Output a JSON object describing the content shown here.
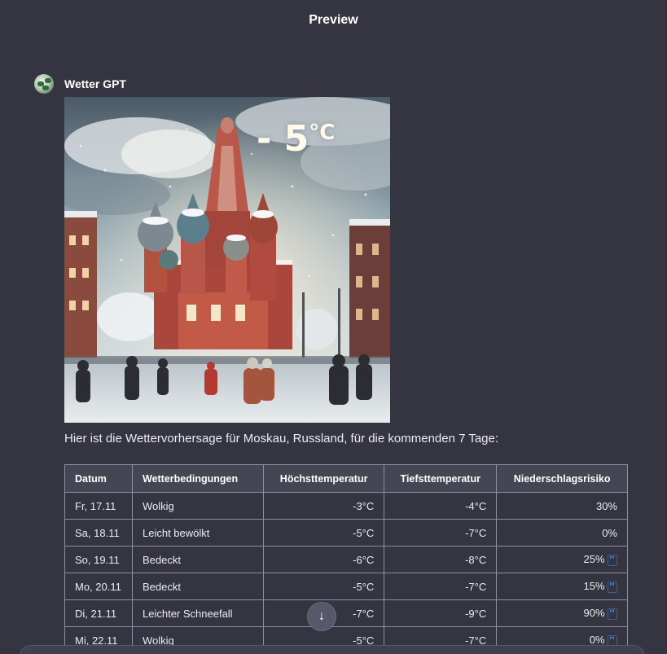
{
  "header": {
    "title": "Preview"
  },
  "message": {
    "author": "Wetter GPT",
    "image": {
      "temperature_overlay": "- 5",
      "temperature_unit": "°C"
    },
    "intro": "Hier ist die Wettervorhersage für Moskau, Russland, für die kommenden 7 Tage:"
  },
  "forecast": {
    "columns": [
      "Datum",
      "Wetterbedingungen",
      "Höchsttemperatur",
      "Tiefsttemperatur",
      "Niederschlagsrisiko"
    ],
    "rows": [
      {
        "date": "Fr, 17.11",
        "condition": "Wolkig",
        "high": "-3°C",
        "low": "-4°C",
        "precip": "30%",
        "precip_icon": false
      },
      {
        "date": "Sa, 18.11",
        "condition": "Leicht bewölkt",
        "high": "-5°C",
        "low": "-7°C",
        "precip": "0%",
        "precip_icon": false
      },
      {
        "date": "So, 19.11",
        "condition": "Bedeckt",
        "high": "-6°C",
        "low": "-8°C",
        "precip": "25%",
        "precip_icon": true
      },
      {
        "date": "Mo, 20.11",
        "condition": "Bedeckt",
        "high": "-5°C",
        "low": "-7°C",
        "precip": "15%",
        "precip_icon": true
      },
      {
        "date": "Di, 21.11",
        "condition": "Leichter Schneefall",
        "high": "-7°C",
        "low": "-9°C",
        "precip": "90%",
        "precip_icon": true
      },
      {
        "date": "Mi, 22.11",
        "condition": "Wolkig",
        "high": "-5°C",
        "low": "-7°C",
        "precip": "0%",
        "precip_icon": true
      }
    ],
    "precip_icon_glyph": "❜❜"
  },
  "scroll_button": {
    "icon": "arrow-down-icon",
    "glyph": "↓"
  },
  "colors": {
    "background": "#343541",
    "table_header": "#444654",
    "border": "#8e8ea0",
    "accent_blue": "#4f8ee8"
  }
}
